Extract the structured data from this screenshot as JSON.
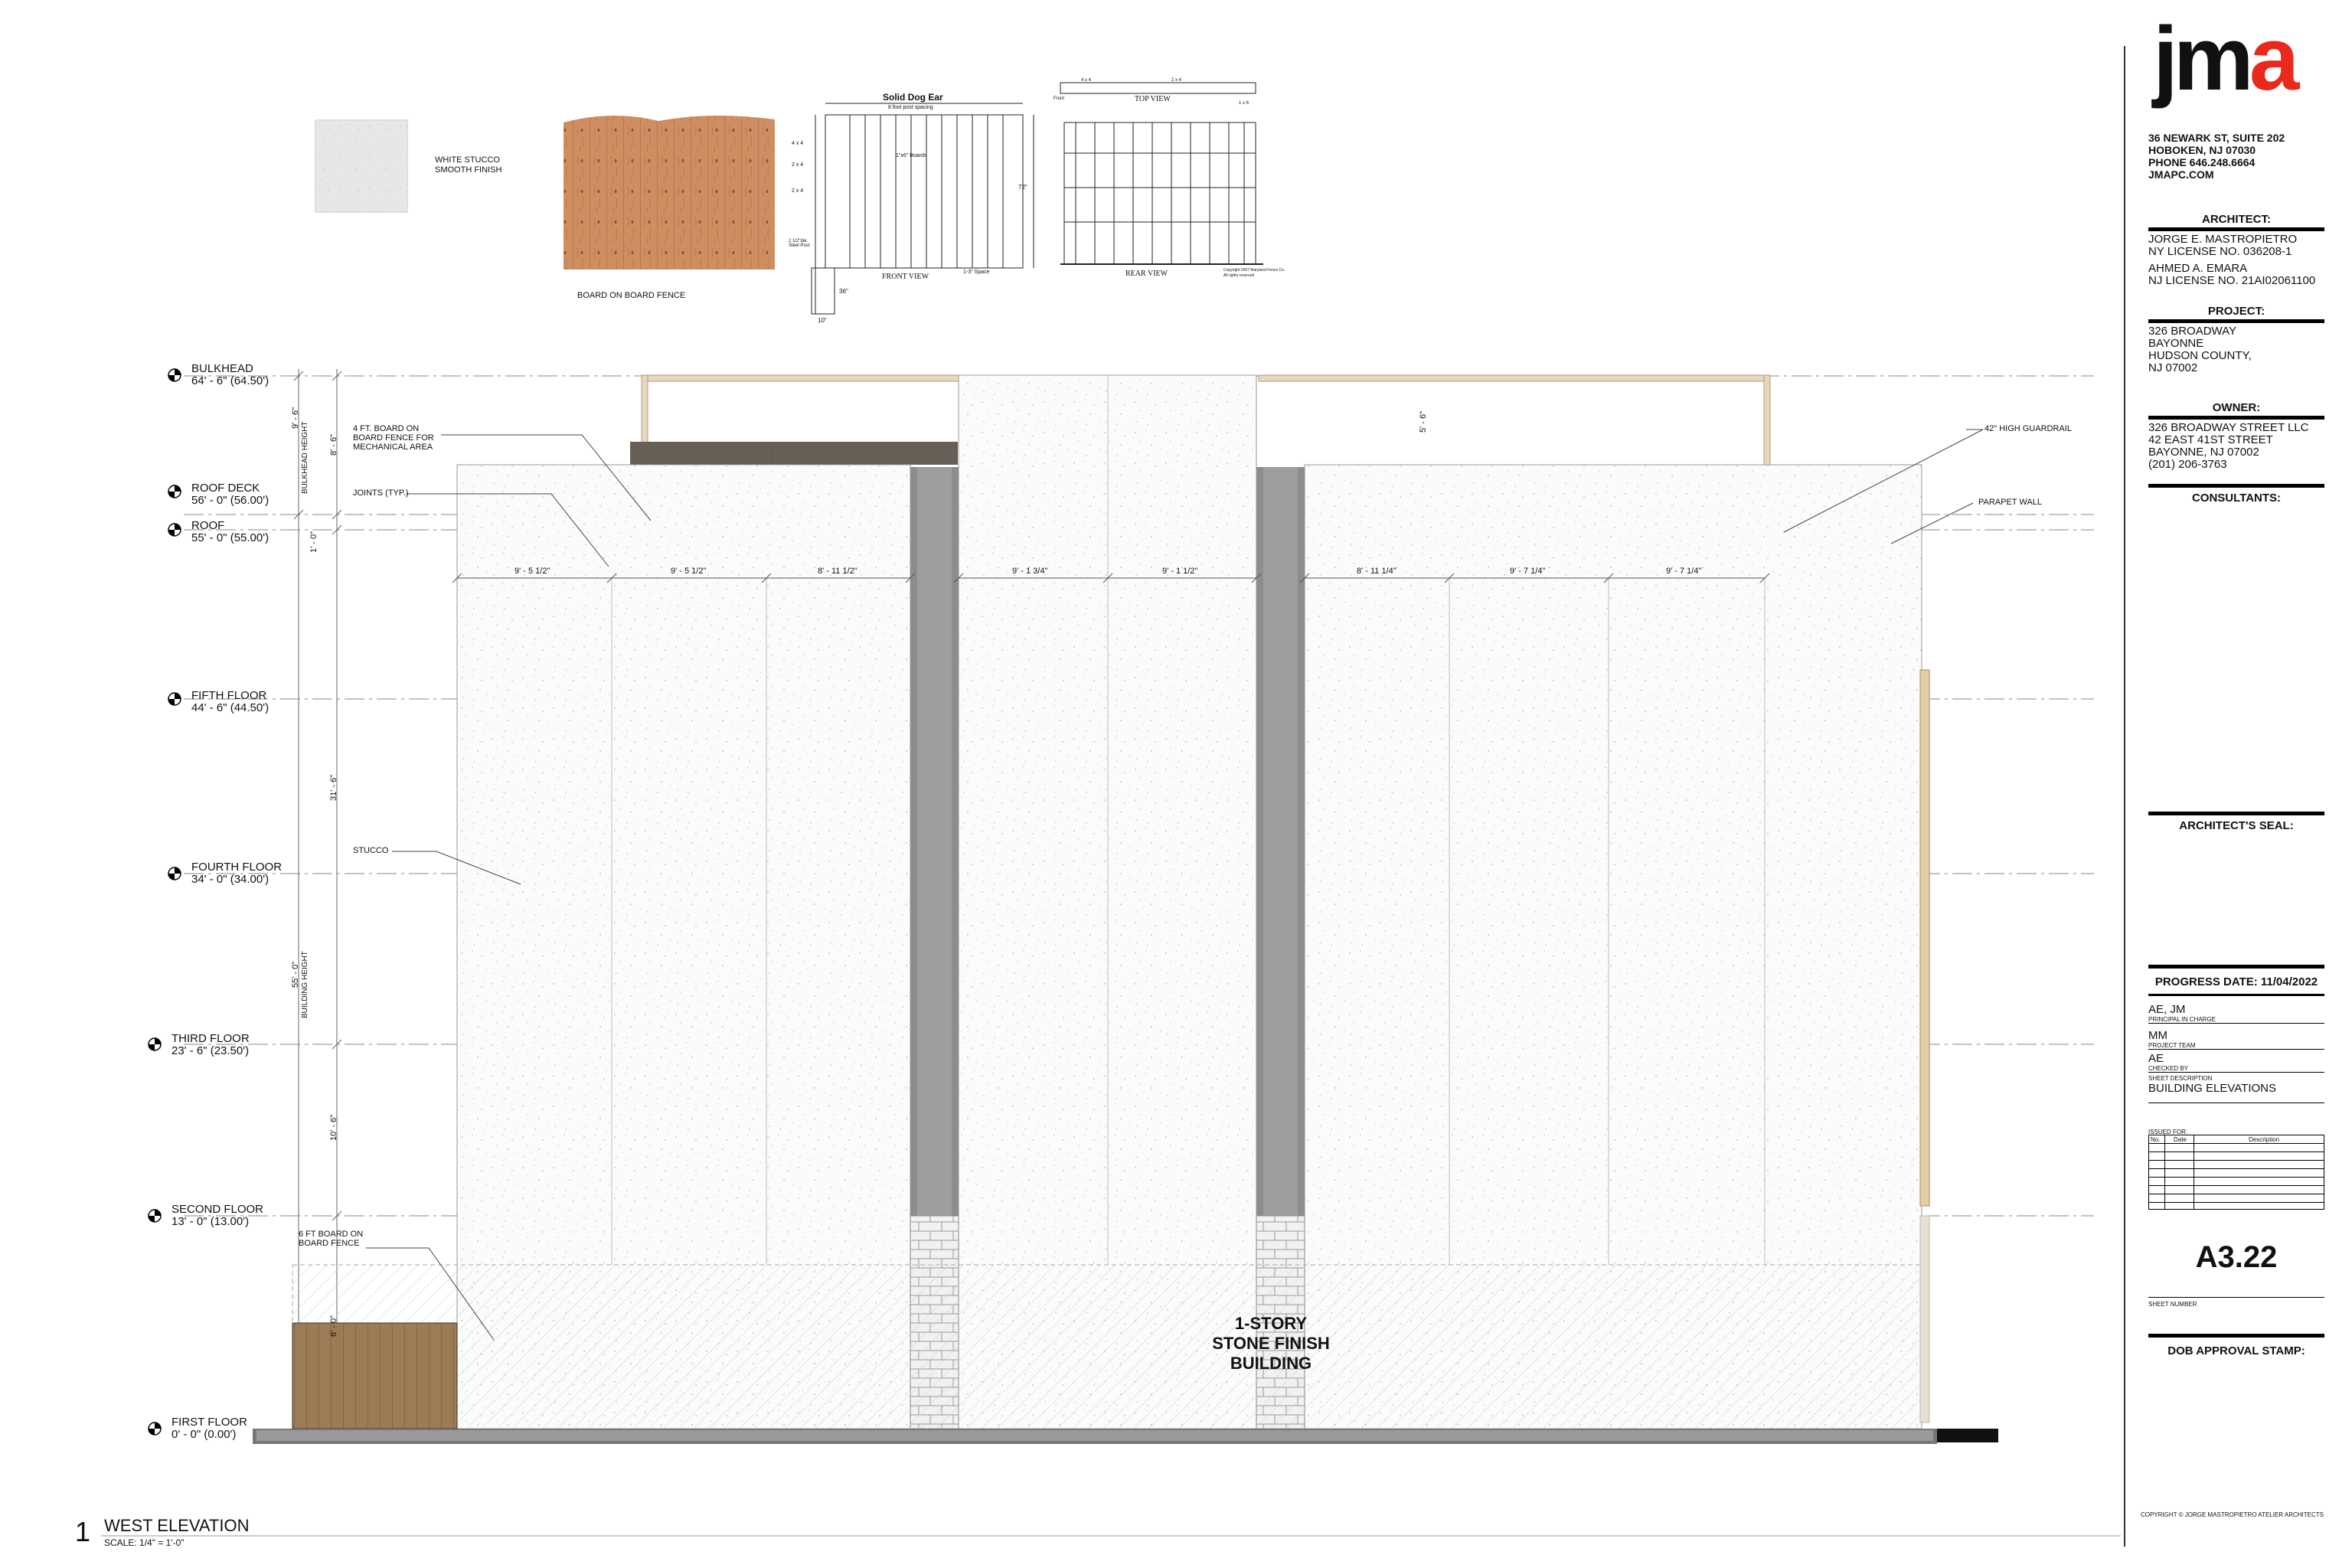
{
  "materials": {
    "stucco_label": [
      "WHITE STUCCO",
      "SMOOTH FINISH"
    ],
    "fence_label": "BOARD ON BOARD FENCE",
    "fence_detail": {
      "title": "Solid Dog Ear",
      "post_spacing": "8 foot post spacing",
      "front_view": "FRONT VIEW",
      "rear_view": "REAR VIEW",
      "top_view": "TOP VIEW",
      "board_note": "1\"x6\" Boards",
      "spacing_note": "1-3\" Space",
      "height_label": "72\"",
      "depth_label": "36\"",
      "width_label": "10\"",
      "rail_labels": [
        "4 x 4",
        "2 x 4",
        "2 x 4"
      ],
      "post_note": "2 1/2\"dia. Steel Post",
      "board_top": "1 x 6",
      "top_labels": [
        "4 x 4",
        "2 x 4"
      ],
      "top_front": "Front",
      "copyright": [
        "Copyright 2007 Maryland Fence Co.",
        "All rights reserved"
      ]
    }
  },
  "levels": [
    {
      "name": "BULKHEAD",
      "elev": "64' - 6\"  (64.50')"
    },
    {
      "name": "ROOF DECK",
      "elev": "56' - 0\"  (56.00')"
    },
    {
      "name": "ROOF",
      "elev": "55' - 0\"  (55.00')"
    },
    {
      "name": "FIFTH FLOOR",
      "elev": "44' - 6\"  (44.50')"
    },
    {
      "name": "FOURTH FLOOR",
      "elev": "34' - 0\"  (34.00')"
    },
    {
      "name": "THIRD FLOOR",
      "elev": "23' - 6\"  (23.50')"
    },
    {
      "name": "SECOND FLOOR",
      "elev": "13' - 0\"  (13.00')"
    },
    {
      "name": "FIRST FLOOR",
      "elev": "0' - 0\"  (0.00')"
    }
  ],
  "annotations": {
    "fence_mech": [
      "4 FT. BOARD ON",
      "BOARD FENCE FOR",
      "MECHANICAL AREA"
    ],
    "joints": "JOINTS (TYP.)",
    "stucco": "STUCCO",
    "fence_6ft": [
      "6 FT BOARD ON",
      "BOARD FENCE"
    ],
    "guardrail": "42\" HIGH GUARDRAIL",
    "parapet": "PARAPET WALL",
    "stone_building": [
      "1-STORY",
      "STONE FINISH",
      "BUILDING"
    ]
  },
  "dimensions": {
    "panels": [
      "9' - 5 1/2\"",
      "9' - 5 1/2\"",
      "8' - 11 1/2\"",
      "9' - 1 3/4\"",
      "9' - 1 1/2\"",
      "8' - 11 1/4\"",
      "9' - 7 1/4\"",
      "9' - 7 1/4\""
    ],
    "bulkhead_height": "9' - 6\"",
    "bulkhead_height_label": "BULKHEAD HEIGHT",
    "fence_height_top": "8' - 6\"",
    "parapet_one": "1' - 0\"",
    "building_upper": "31' - 6\"",
    "building_height": "55' - 0\"",
    "building_height_label": "BUILDING HEIGHT",
    "floor_lower": "10' - 6\"",
    "fence_low": "6' - 0\"",
    "guard_5": "5' - 6\""
  },
  "view": {
    "number": "1",
    "title": "WEST ELEVATION",
    "scale": "SCALE:  1/4\" = 1'-0\""
  },
  "titleblock": {
    "logo": {
      "jm": "jm",
      "a": "a",
      "a_color": "#e8291b"
    },
    "address": [
      "36 NEWARK ST, SUITE 202",
      "HOBOKEN, NJ 07030",
      "PHONE 646.248.6664",
      "JMAPC.COM"
    ],
    "architect_heading": "ARCHITECT:",
    "architects": [
      "JORGE E. MASTROPIETRO",
      "NY LICENSE NO. 036208-1",
      "AHMED A. EMARA",
      "NJ LICENSE NO. 21AI02061100"
    ],
    "project_heading": "PROJECT:",
    "project": [
      "326 BROADWAY",
      "BAYONNE",
      "HUDSON COUNTY,",
      "NJ 07002"
    ],
    "owner_heading": "OWNER:",
    "owner": [
      "326 BROADWAY STREET LLC",
      "42 EAST 41ST STREET",
      "BAYONNE, NJ 07002",
      "(201) 206-3763"
    ],
    "consultants_heading": "CONSULTANTS:",
    "seal_heading": "ARCHITECT'S SEAL:",
    "progress": "PROGRESS DATE: 11/04/2022",
    "principal": "AE, JM",
    "principal_label": "PRINCIPAL IN CHARGE",
    "team": "MM",
    "team_label": "PROJECT TEAM",
    "checked": "AE",
    "checked_label": "CHECKED BY",
    "desc_label": "SHEET DESCRIPTION",
    "desc": "BUILDING ELEVATIONS",
    "issued_label": "ISSUED FOR:",
    "issue_cols": [
      "No.",
      "Date",
      "Description"
    ],
    "sheet_number": "A3.22",
    "sheet_number_label": "SHEET NUMBER",
    "dob_heading": "DOB APPROVAL STAMP:",
    "copyright": "COPYRIGHT © JORGE MASTROPIETRO ATELIER ARCHITECTS"
  }
}
